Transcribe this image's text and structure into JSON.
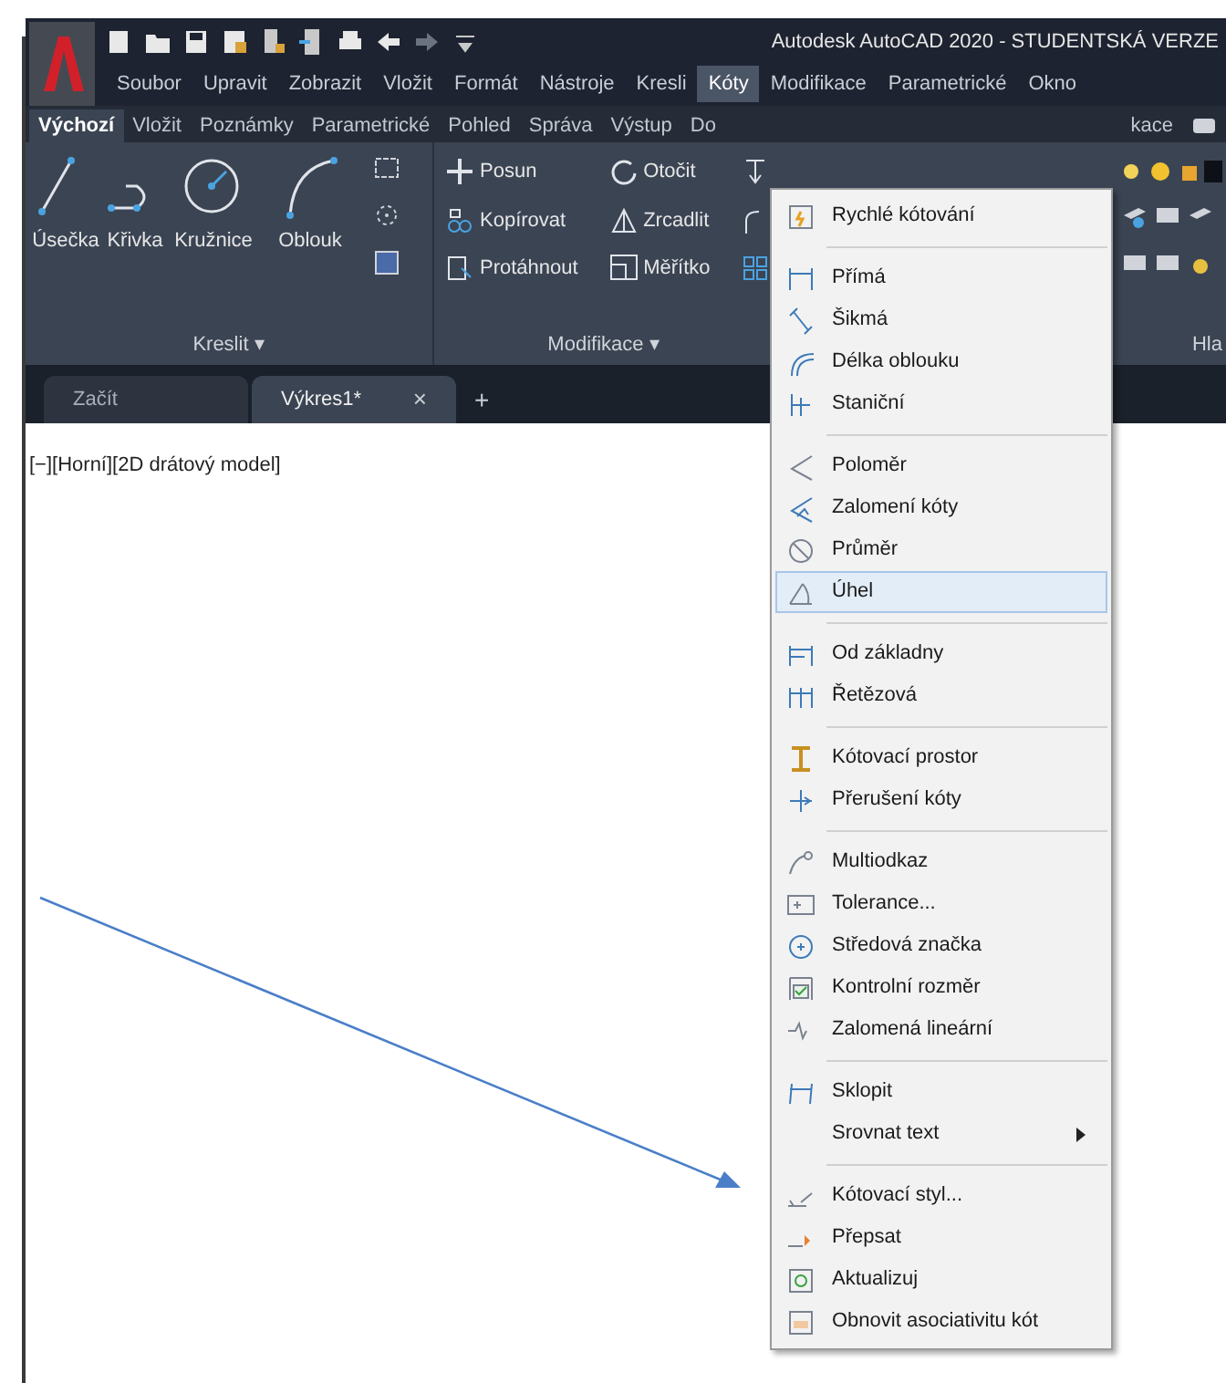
{
  "app": {
    "title": "Autodesk AutoCAD 2020 - STUDENTSKÁ VERZE"
  },
  "menu_bar": [
    {
      "label": "Soubor",
      "selected": false
    },
    {
      "label": "Upravit",
      "selected": false
    },
    {
      "label": "Zobrazit",
      "selected": false
    },
    {
      "label": "Vložit",
      "selected": false
    },
    {
      "label": "Formát",
      "selected": false
    },
    {
      "label": "Nástroje",
      "selected": false
    },
    {
      "label": "Kresli",
      "selected": false
    },
    {
      "label": "Kóty",
      "selected": true
    },
    {
      "label": "Modifikace",
      "selected": false
    },
    {
      "label": "Parametrické",
      "selected": false
    },
    {
      "label": "Okno",
      "selected": false
    }
  ],
  "ribbon_tabs": [
    {
      "label": "Výchozí",
      "selected": true
    },
    {
      "label": "Vložit",
      "selected": false
    },
    {
      "label": "Poznámky",
      "selected": false
    },
    {
      "label": "Parametrické",
      "selected": false
    },
    {
      "label": "Pohled",
      "selected": false
    },
    {
      "label": "Správa",
      "selected": false
    },
    {
      "label": "Výstup",
      "selected": false
    },
    {
      "label": "Do",
      "selected": false
    },
    {
      "label": "kace",
      "selected": false
    }
  ],
  "draw_panel": {
    "title": "Kreslit ▾",
    "tools": [
      "Úsečka",
      "Křivka",
      "Kružnice",
      "Oblouk"
    ]
  },
  "modify_panel": {
    "title": "Modifikace ▾",
    "tools": [
      "Posun",
      "Otočit",
      "Kopírovat",
      "Zrcadlit",
      "Protáhnout",
      "Měřítko"
    ]
  },
  "layers_panel": {
    "title": "Hla"
  },
  "doc_tabs": [
    {
      "label": "Začít",
      "selected": false
    },
    {
      "label": "Výkres1*",
      "selected": true,
      "close": "×"
    }
  ],
  "new_tab": "+",
  "viewport": {
    "label": "[−][Horní][2D drátový model]"
  },
  "dimension_menu": {
    "groups": [
      [
        {
          "label": "Rychlé kótování",
          "selected": false,
          "submenu": false
        }
      ],
      [
        {
          "label": "Přímá",
          "selected": false,
          "submenu": false
        },
        {
          "label": "Šikmá",
          "selected": false,
          "submenu": false
        },
        {
          "label": "Délka oblouku",
          "selected": false,
          "submenu": false
        },
        {
          "label": "Staniční",
          "selected": false,
          "submenu": false
        }
      ],
      [
        {
          "label": "Poloměr",
          "selected": false,
          "submenu": false
        },
        {
          "label": "Zalomení kóty",
          "selected": false,
          "submenu": false
        },
        {
          "label": "Průměr",
          "selected": false,
          "submenu": false
        },
        {
          "label": "Úhel",
          "selected": true,
          "submenu": false
        }
      ],
      [
        {
          "label": "Od základny",
          "selected": false,
          "submenu": false
        },
        {
          "label": "Řetězová",
          "selected": false,
          "submenu": false
        }
      ],
      [
        {
          "label": "Kótovací prostor",
          "selected": false,
          "submenu": false
        },
        {
          "label": "Přerušení kóty",
          "selected": false,
          "submenu": false
        }
      ],
      [
        {
          "label": "Multiodkaz",
          "selected": false,
          "submenu": false
        },
        {
          "label": "Tolerance...",
          "selected": false,
          "submenu": false
        },
        {
          "label": "Středová značka",
          "selected": false,
          "submenu": false
        },
        {
          "label": "Kontrolní rozměr",
          "selected": false,
          "submenu": false
        },
        {
          "label": "Zalomená lineární",
          "selected": false,
          "submenu": false
        }
      ],
      [
        {
          "label": "Sklopit",
          "selected": false,
          "submenu": false
        },
        {
          "label": "Srovnat text",
          "selected": false,
          "submenu": true
        }
      ],
      [
        {
          "label": "Kótovací styl...",
          "selected": false,
          "submenu": false
        },
        {
          "label": "Přepsat",
          "selected": false,
          "submenu": false
        },
        {
          "label": "Aktualizuj",
          "selected": false,
          "submenu": false
        },
        {
          "label": "Obnovit asociativitu kót",
          "selected": false,
          "submenu": false
        }
      ]
    ]
  }
}
